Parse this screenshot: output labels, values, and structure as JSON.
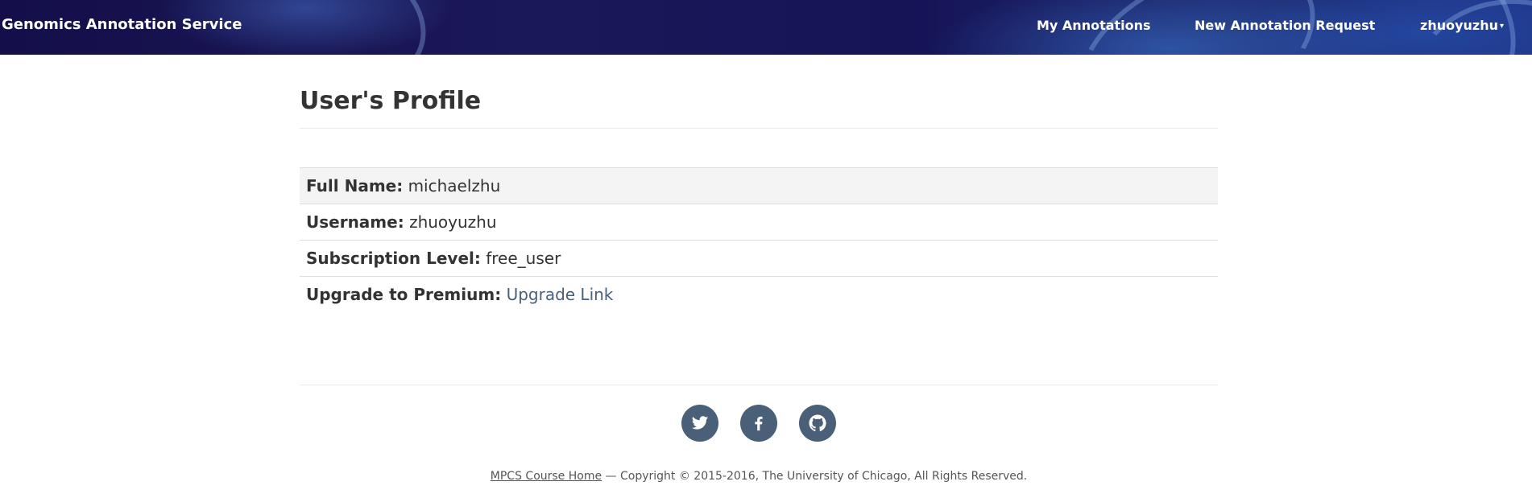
{
  "navbar": {
    "brand": "Genomics Annotation Service",
    "links": [
      {
        "label": "My Annotations"
      },
      {
        "label": "New Annotation Request"
      }
    ],
    "user_menu": {
      "label": "zhuoyuzhu"
    }
  },
  "page": {
    "title": "User's Profile"
  },
  "profile": {
    "full_name": {
      "label": "Full Name:",
      "value": "michaelzhu"
    },
    "username": {
      "label": "Username:",
      "value": "zhuoyuzhu"
    },
    "subscription": {
      "label": "Subscription Level:",
      "value": "free_user"
    },
    "upgrade": {
      "label": "Upgrade to Premium:",
      "link_text": "Upgrade Link"
    }
  },
  "footer": {
    "social": [
      {
        "icon": "twitter-icon"
      },
      {
        "icon": "facebook-icon"
      },
      {
        "icon": "github-icon"
      }
    ],
    "course_link": "MPCS Course Home",
    "copyright": " — Copyright © 2015-2016, The University of Chicago, All Rights Reserved."
  },
  "colors": {
    "navbar_bg": "#1b1858",
    "link": "#4a5f7a",
    "social_bg": "#4a5f78"
  }
}
